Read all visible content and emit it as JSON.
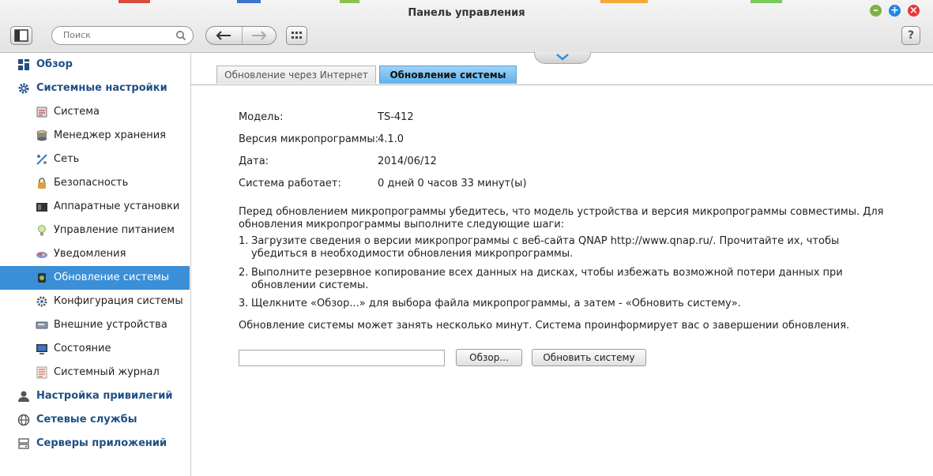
{
  "window": {
    "title": "Панель управления"
  },
  "toolbar": {
    "search_placeholder": "Поиск"
  },
  "sidebar": {
    "items": [
      {
        "label": "Обзор",
        "level": "top",
        "icon": "overview-icon"
      },
      {
        "label": "Системные настройки",
        "level": "top",
        "icon": "gear-icon"
      },
      {
        "label": "Система",
        "level": "sub",
        "icon": "system-icon"
      },
      {
        "label": "Менеджер хранения",
        "level": "sub",
        "icon": "storage-icon"
      },
      {
        "label": "Сеть",
        "level": "sub",
        "icon": "network-icon"
      },
      {
        "label": "Безопасность",
        "level": "sub",
        "icon": "lock-icon"
      },
      {
        "label": "Аппаратные установки",
        "level": "sub",
        "icon": "hardware-icon"
      },
      {
        "label": "Управление питанием",
        "level": "sub",
        "icon": "bulb-icon"
      },
      {
        "label": "Уведомления",
        "level": "sub",
        "icon": "notification-icon"
      },
      {
        "label": "Обновление системы",
        "level": "sub",
        "icon": "firmware-update-icon",
        "active": true
      },
      {
        "label": "Конфигурация системы",
        "level": "sub",
        "icon": "config-icon"
      },
      {
        "label": "Внешние устройства",
        "level": "sub",
        "icon": "external-device-icon"
      },
      {
        "label": "Состояние",
        "level": "sub",
        "icon": "monitor-icon"
      },
      {
        "label": "Системный журнал",
        "level": "sub",
        "icon": "log-icon"
      },
      {
        "label": "Настройка привилегий",
        "level": "top",
        "icon": "user-icon"
      },
      {
        "label": "Сетевые службы",
        "level": "top",
        "icon": "network-services-icon"
      },
      {
        "label": "Серверы приложений",
        "level": "top",
        "icon": "app-server-icon"
      }
    ]
  },
  "tabs": [
    {
      "label": "Обновление через Интернет",
      "active": false
    },
    {
      "label": "Обновление системы",
      "active": true
    }
  ],
  "info": {
    "model_label": "Модель:",
    "model_value": "TS-412",
    "fw_label": "Версия микропрограммы:",
    "fw_value": "4.1.0",
    "date_label": "Дата:",
    "date_value": "2014/06/12",
    "uptime_label": "Система работает:",
    "uptime_value": "0 дней 0 часов 33 минут(ы)"
  },
  "instructions": {
    "intro": "Перед обновлением микропрограммы убедитесь, что модель устройства и версия микропрограммы совместимы. Для обновления микропрограммы выполните следующие шаги:",
    "step1_num": "1.",
    "step1_a": "Загрузите сведения о версии микропрограммы с веб-сайта QNAP ",
    "step1_link": "http://www.qnap.ru/",
    "step1_b": ". Прочитайте их, чтобы убедиться в необходимости обновления микропрограммы.",
    "step2_num": "2.",
    "step2": "Выполните резервное копирование всех данных на дисках, чтобы избежать возможной потери данных при обновлении системы.",
    "step3_num": "3.",
    "step3": "Щелкните «Обзор...» для выбора файла микропрограммы, а затем - «Обновить систему».",
    "note": "Обновление системы может занять несколько минут. Система проинформирует вас о завершении обновления."
  },
  "actions": {
    "file_value": "",
    "browse_label": "Обзор...",
    "update_label": "Обновить систему"
  },
  "colors": {
    "active_item": "#3a8fd6",
    "active_tab": "#5cb2ec",
    "top_item_text": "#1f4f86",
    "link": "#1a6fc7",
    "minimize": "#7cb342",
    "maximize": "#1e88e5",
    "close": "#e53935"
  }
}
